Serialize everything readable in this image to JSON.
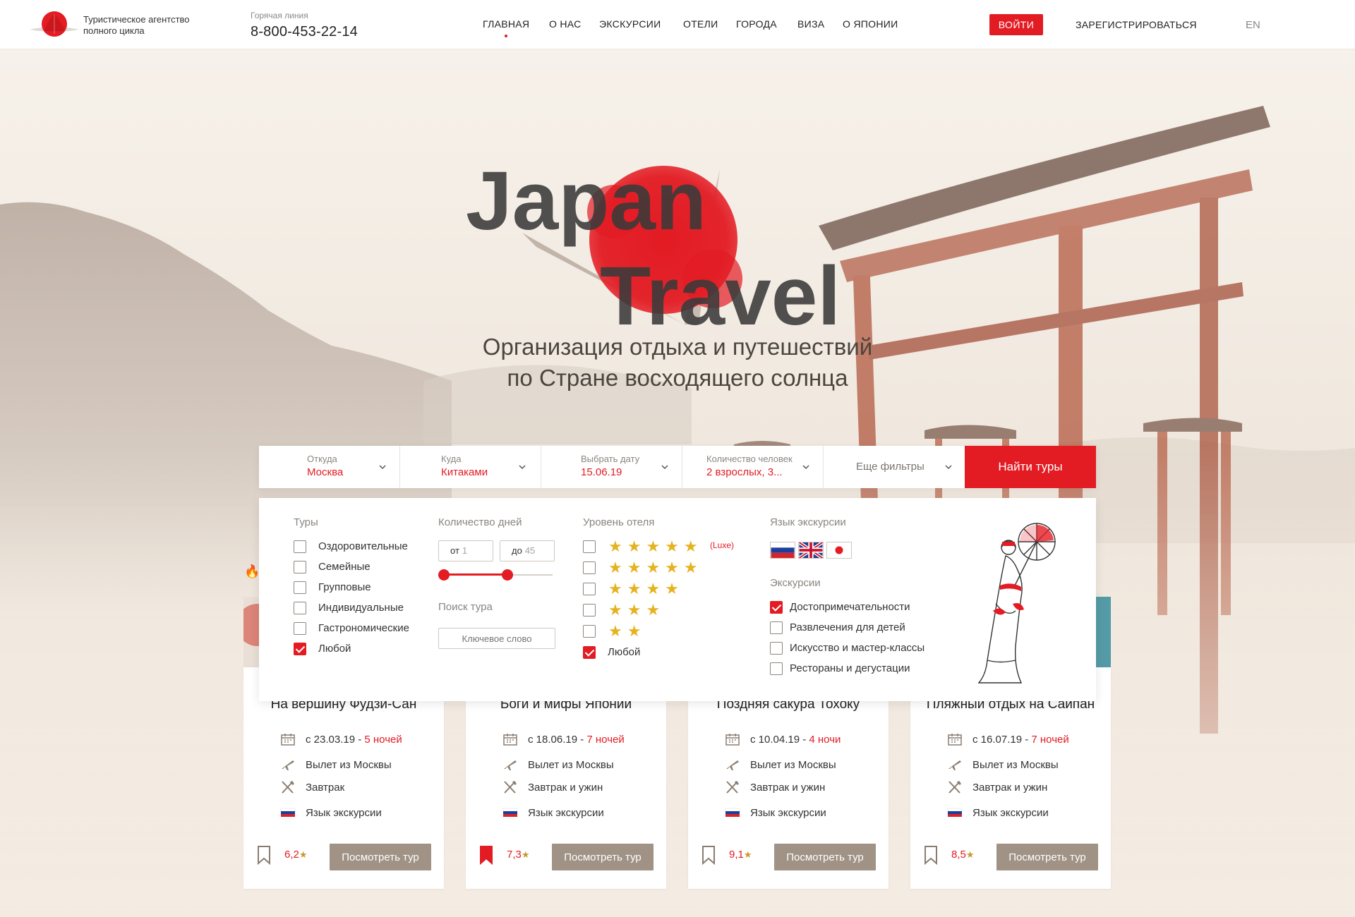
{
  "header": {
    "tagline": "Туристическое агентство полного цикла",
    "hotline_label": "Горячая линия",
    "hotline_phone": "8-800-453-22-14",
    "nav": [
      "ГЛАВНАЯ",
      "О НАС",
      "ЭКСКУРСИИ",
      "ОТЕЛИ",
      "ГОРОДА",
      "ВИЗА",
      "О ЯПОНИИ"
    ],
    "login": "ВОЙТИ",
    "register": "ЗАРЕГИСТРИРОВАТЬСЯ",
    "lang": "EN",
    "brand_color": "#e31b23"
  },
  "hero": {
    "logo_line1": "Japan",
    "logo_line2": "Travel",
    "subtitle_line1": "Организация отдыха  и путешествий",
    "subtitle_line2": "по Стране восходящего солнца"
  },
  "search": {
    "from_label": "Откуда",
    "from_value": "Москва",
    "to_label": "Куда",
    "to_value": "Китаками",
    "date_label": "Выбрать дату",
    "date_value": "15.06.19",
    "people_label": "Количество человек",
    "people_value": "2 взрослых, 3...",
    "more_filters": "Еще фильтры",
    "find_button": "Найти туры"
  },
  "filters": {
    "tours_title": "Туры",
    "tours": [
      {
        "label": "Оздоровительные",
        "checked": false
      },
      {
        "label": "Семейные",
        "checked": false
      },
      {
        "label": "Групповые",
        "checked": false
      },
      {
        "label": "Индивидуальные",
        "checked": false
      },
      {
        "label": "Гастрономические",
        "checked": false
      },
      {
        "label": "Любой",
        "checked": true
      }
    ],
    "days_title": "Количество дней",
    "days_from_prefix": "от",
    "days_from": "1",
    "days_to_prefix": "до",
    "days_to": "45",
    "search_title": "Поиск тура",
    "keyword_placeholder": "Ключевое слово",
    "hotel_title": "Уровень отеля",
    "hotel_levels": [
      {
        "stars": 5,
        "extra": "(Luxe)",
        "checked": false
      },
      {
        "stars": 5,
        "extra": "",
        "checked": false
      },
      {
        "stars": 4,
        "extra": "",
        "checked": false
      },
      {
        "stars": 3,
        "extra": "",
        "checked": false
      },
      {
        "stars": 2,
        "extra": "",
        "checked": false
      }
    ],
    "hotel_any": "Любой",
    "hotel_any_checked": true,
    "lang_title": "Язык экскурсии",
    "flags": [
      "russia-flag-icon",
      "uk-flag-icon",
      "japan-flag-icon"
    ],
    "excursions_title": "Экскурсии",
    "excursions": [
      {
        "label": "Достопримечательности",
        "checked": true
      },
      {
        "label": "Развлечения для детей",
        "checked": false
      },
      {
        "label": "Искусство и мастер-классы",
        "checked": false
      },
      {
        "label": "Рестораны и дегустации",
        "checked": false
      }
    ]
  },
  "cards": [
    {
      "title": "На вершину Фудзи-Сан",
      "date": "с 23.03.19 - ",
      "nights": "5 ночей",
      "departure": "Вылет из Москвы",
      "meal": "Завтрак",
      "language": "Язык экскурсии",
      "rating": "6,2",
      "saved": false,
      "button": "Посмотреть тур"
    },
    {
      "title": "Боги и мифы Японии",
      "date": "с 18.06.19 - ",
      "nights": "7 ночей",
      "departure": "Вылет из Москвы",
      "meal": "Завтрак и ужин",
      "language": "Язык экскурсии",
      "rating": "7,3",
      "saved": true,
      "button": "Посмотреть тур"
    },
    {
      "title": "Поздняя сакура Тохоку",
      "date": "с 10.04.19 - ",
      "nights": "4 ночи",
      "departure": "Вылет из Москвы",
      "meal": "Завтрак и ужин",
      "language": "Язык экскурсии",
      "rating": "9,1",
      "saved": false,
      "button": "Посмотреть тур"
    },
    {
      "title": "Пляжный отдых на Сайпан",
      "date": "с 16.07.19 - ",
      "nights": "7 ночей",
      "departure": "Вылет из Москвы",
      "meal": "Завтрак и ужин",
      "language": "Язык экскурсии",
      "rating": "8,5",
      "saved": false,
      "button": "Посмотреть тур"
    }
  ]
}
